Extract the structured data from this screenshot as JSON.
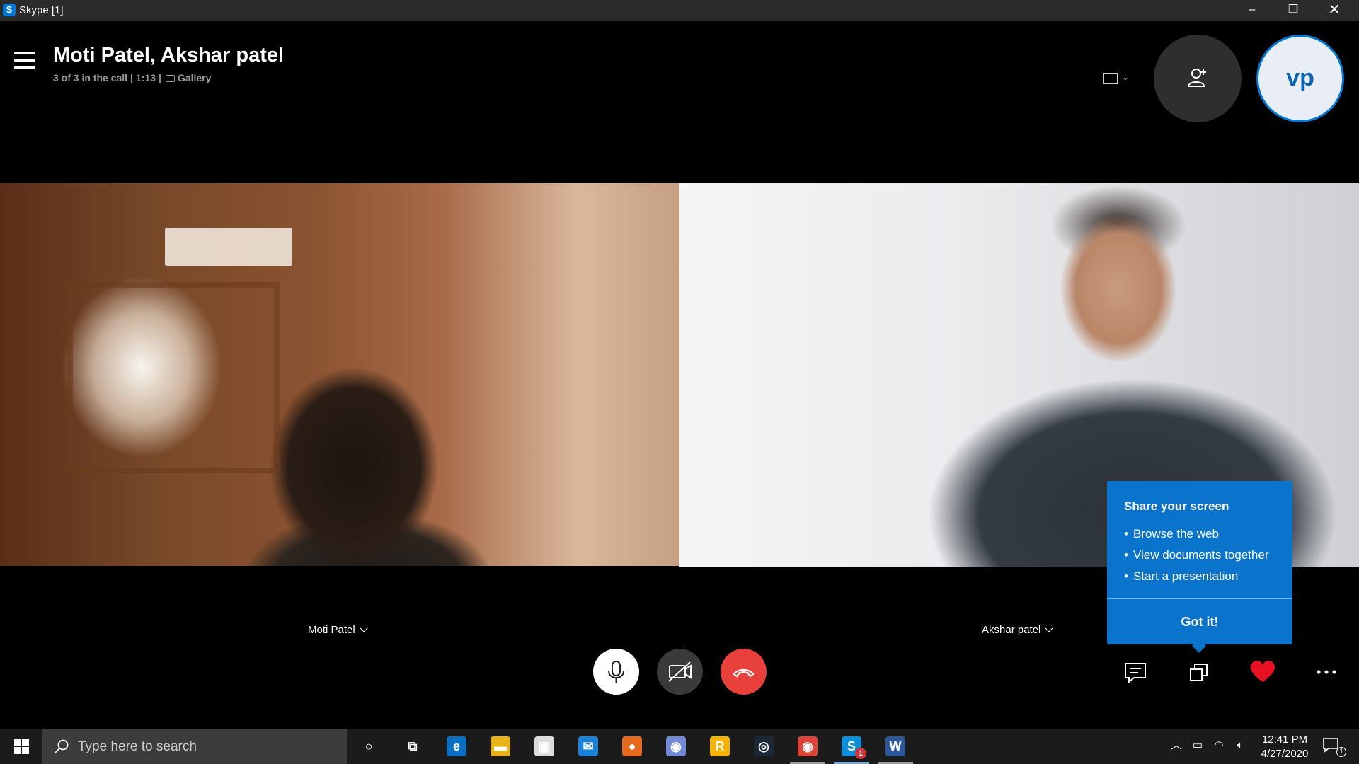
{
  "window": {
    "title": "Skype [1]",
    "app_icon": "S",
    "controls": {
      "minimize": "–",
      "restore": "❐",
      "close": "✕"
    }
  },
  "call": {
    "title": "Moti Patel, Akshar patel",
    "participants": "3 of 3 in the call",
    "duration": "1:13",
    "view_mode": "Gallery",
    "self_avatar_initials": "vp"
  },
  "participants": [
    {
      "name": "Moti Patel"
    },
    {
      "name": "Akshar patel"
    }
  ],
  "tooltip": {
    "title": "Share your screen",
    "items": [
      "Browse the web",
      "View documents together",
      "Start a presentation"
    ],
    "button": "Got it!"
  },
  "taskbar": {
    "search_placeholder": "Type here to search",
    "apps": [
      {
        "name": "cortana-icon",
        "glyph": "○",
        "color": "transparent"
      },
      {
        "name": "task-view-icon",
        "glyph": "⧉",
        "color": "transparent"
      },
      {
        "name": "edge-icon",
        "glyph": "e",
        "color": "#0a6fc2"
      },
      {
        "name": "file-explorer-icon",
        "glyph": "▬",
        "color": "#e8b21a"
      },
      {
        "name": "store-icon",
        "glyph": "▣",
        "color": "#dcdcdc"
      },
      {
        "name": "mail-icon",
        "glyph": "✉",
        "color": "#1a82d8"
      },
      {
        "name": "firefox-icon",
        "glyph": "●",
        "color": "#e66a1e"
      },
      {
        "name": "discord-icon",
        "glyph": "◉",
        "color": "#7289da"
      },
      {
        "name": "rockstar-icon",
        "glyph": "R",
        "color": "#f4b400"
      },
      {
        "name": "steam-icon",
        "glyph": "◎",
        "color": "#1b2838"
      },
      {
        "name": "chrome-icon",
        "glyph": "◉",
        "color": "#db4437"
      },
      {
        "name": "skype-icon",
        "glyph": "S",
        "color": "#0a8fd8",
        "badge": "1"
      },
      {
        "name": "word-icon",
        "glyph": "W",
        "color": "#2b579a"
      }
    ],
    "time": "12:41 PM",
    "date": "4/27/2020",
    "notification_count": "1"
  },
  "colors": {
    "accent": "#0078d4",
    "hangup": "#e8413c",
    "react_heart": "#e81123",
    "tooltip_bg": "#0a74cc"
  }
}
